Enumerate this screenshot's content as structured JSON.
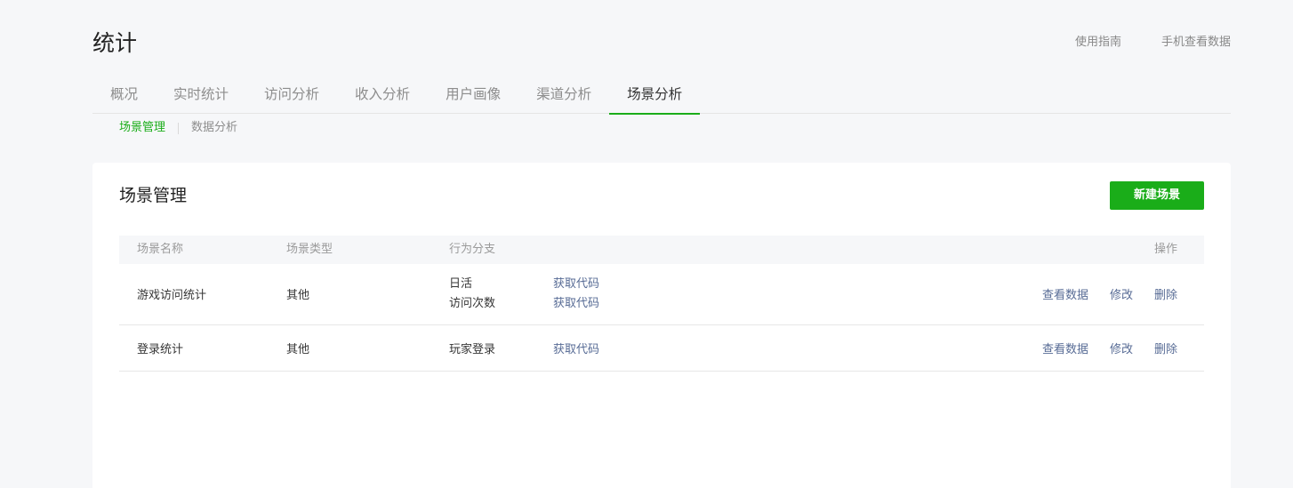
{
  "header": {
    "title": "统计",
    "links": [
      "使用指南",
      "手机查看数据"
    ]
  },
  "tabs": [
    "概况",
    "实时统计",
    "访问分析",
    "收入分析",
    "用户画像",
    "渠道分析",
    "场景分析"
  ],
  "active_tab": "场景分析",
  "subtabs": [
    "场景管理",
    "数据分析"
  ],
  "active_subtab": "场景管理",
  "card": {
    "title": "场景管理",
    "new_button": "新建场景"
  },
  "table": {
    "headers": {
      "name": "场景名称",
      "type": "场景类型",
      "branch": "行为分支",
      "ops": "操作"
    },
    "rows": [
      {
        "name": "游戏访问统计",
        "type": "其他",
        "branches": [
          {
            "label": "日活",
            "code_link": "获取代码"
          },
          {
            "label": "访问次数",
            "code_link": "获取代码"
          }
        ],
        "ops": [
          "查看数据",
          "修改",
          "删除"
        ]
      },
      {
        "name": "登录统计",
        "type": "其他",
        "branches": [
          {
            "label": "玩家登录",
            "code_link": "获取代码"
          }
        ],
        "ops": [
          "查看数据",
          "修改",
          "删除"
        ]
      }
    ]
  },
  "colors": {
    "accent": "#1aad19",
    "link": "#576b95",
    "page_bg": "#f6f7f9"
  }
}
